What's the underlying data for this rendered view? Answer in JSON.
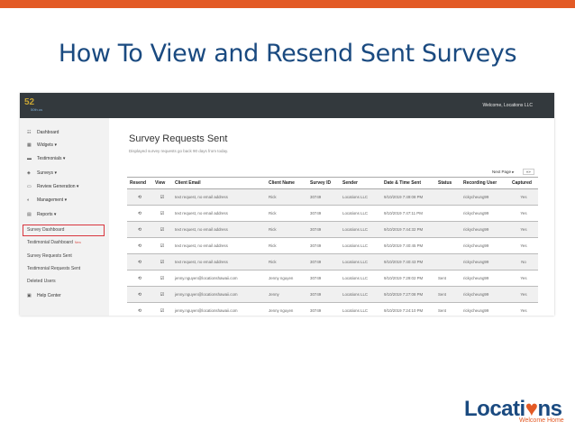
{
  "slide": {
    "title": "How To View and Resend Sent Surveys",
    "brand": {
      "pre": "Locati",
      "accent": "♥",
      "post": "ns",
      "tagline": "Welcome Home"
    }
  },
  "app": {
    "logo_mark": "52",
    "logo_text": "50th.us",
    "welcome": "Welcome, Locations LLC",
    "sidebar": {
      "items": [
        {
          "icon": "☷",
          "label": "Dashboard"
        },
        {
          "icon": "▦",
          "label": "Widgets ▾"
        },
        {
          "icon": "▬",
          "label": "Testimonials ▾"
        },
        {
          "icon": "◈",
          "label": "Surveys ▾"
        },
        {
          "icon": "▭",
          "label": "Review Generation ▾"
        },
        {
          "icon": "◐",
          "label": "Management ▾"
        },
        {
          "icon": "▤",
          "label": "Reports ▾"
        }
      ],
      "reports_sub": [
        {
          "label": "Survey Dashboard"
        },
        {
          "label": "Testimonial Dashboard",
          "badge": "New"
        },
        {
          "label": "Survey Requests Sent"
        },
        {
          "label": "Testimonial Requests Sent"
        },
        {
          "label": "Deleted Users"
        }
      ],
      "help": {
        "icon": "▣",
        "label": "Help Center"
      }
    },
    "page": {
      "heading": "Survey Requests Sent",
      "subheading": "Displayed survey requests go back 90 days from today.",
      "pager": {
        "next": "Next Page ▸",
        "last": "»»"
      },
      "columns": [
        "Resend",
        "View",
        "Client Email",
        "Client Name",
        "Survey ID",
        "Sender",
        "Date & Time Sent",
        "Status",
        "Recording User",
        "Captured"
      ],
      "rows": [
        {
          "resend": "⟲",
          "view": "☑",
          "email": "text request, no email address",
          "name": "Rick",
          "survey_id": "30749",
          "sender": "Locations LLC",
          "sent": "9/10/2019 7:49:08 PM",
          "status": "",
          "user": "rickycheung99",
          "captured": "Yes"
        },
        {
          "resend": "⟲",
          "view": "☑",
          "email": "text request, no email address",
          "name": "Rick",
          "survey_id": "30749",
          "sender": "Locations LLC",
          "sent": "9/10/2019 7:47:11 PM",
          "status": "",
          "user": "rickycheung99",
          "captured": "Yes"
        },
        {
          "resend": "⟲",
          "view": "☑",
          "email": "text request, no email address",
          "name": "Rick",
          "survey_id": "30749",
          "sender": "Locations LLC",
          "sent": "9/10/2019 7:44:32 PM",
          "status": "",
          "user": "rickycheung99",
          "captured": "Yes"
        },
        {
          "resend": "⟲",
          "view": "☑",
          "email": "text request, no email address",
          "name": "Rick",
          "survey_id": "30749",
          "sender": "Locations LLC",
          "sent": "9/10/2019 7:40:45 PM",
          "status": "",
          "user": "rickycheung99",
          "captured": "Yes"
        },
        {
          "resend": "⟲",
          "view": "☑",
          "email": "text request, no email address",
          "name": "Rick",
          "survey_id": "30749",
          "sender": "Locations LLC",
          "sent": "9/10/2019 7:40:43 PM",
          "status": "",
          "user": "rickycheung99",
          "captured": "No"
        },
        {
          "resend": "⟲",
          "view": "☑",
          "email": "jenny.nguyen@locationshawaii.com",
          "name": "Jenny nguyen",
          "survey_id": "30749",
          "sender": "Locations LLC",
          "sent": "9/10/2019 7:29:02 PM",
          "status": "Sent",
          "user": "rickycheung99",
          "captured": "Yes"
        },
        {
          "resend": "⟲",
          "view": "☑",
          "email": "jenny.nguyen@locationshawaii.com",
          "name": "Jenny",
          "survey_id": "30749",
          "sender": "Locations LLC",
          "sent": "9/10/2019 7:27:08 PM",
          "status": "Sent",
          "user": "rickycheung99",
          "captured": "Yes"
        },
        {
          "resend": "⟲",
          "view": "☑",
          "email": "jenny.nguyen@locationshawaii.com",
          "name": "Jenny nguyen",
          "survey_id": "30749",
          "sender": "Locations LLC",
          "sent": "9/10/2019 7:24:10 PM",
          "status": "Sent",
          "user": "rickycheung99",
          "captured": "Yes"
        }
      ]
    }
  }
}
